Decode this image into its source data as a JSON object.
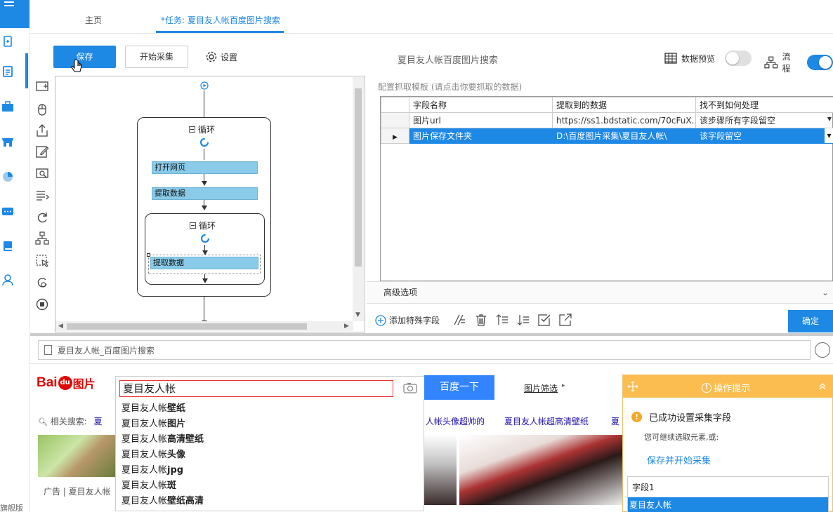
{
  "tabs": {
    "home": "主页",
    "task": "*任务: 夏目友人帐百度图片搜索"
  },
  "toolbar": {
    "save": "保存",
    "start": "开始采集",
    "settings": "设置",
    "task_title": "夏目友人帐百度图片搜索",
    "preview": "数据预览",
    "preview_on": false,
    "flow": "流程",
    "flow_on": true
  },
  "sidebar": {
    "edition": "旗舰版"
  },
  "workflow": {
    "outer_loop": "循环",
    "steps": [
      "打开网页",
      "提取数据"
    ],
    "inner_loop": "循环",
    "inner_step": "提取数据"
  },
  "extract": {
    "panel_title": "配置抓取模板 (请点击你要抓取的数据)",
    "columns": [
      "字段名称",
      "提取到的数据",
      "找不到如何处理"
    ],
    "rows": [
      {
        "name": "图片url",
        "value": "https://ss1.bdstatic.com/70cFuX...",
        "fallback": "该步骤所有字段留空"
      },
      {
        "name": "图片保存文件夹",
        "value": "D:\\百度图片采集\\夏目友人帐\\",
        "fallback": "该字段留空"
      }
    ],
    "selected_row": 1,
    "advanced": "高级选项",
    "add_field": "添加特殊字段",
    "ok": "确定"
  },
  "browser": {
    "address": "夏目友人帐_百度图片搜索",
    "logo_text": "Bai",
    "logo_du": "du",
    "logo_suffix": "图片",
    "query": "夏目友人帐",
    "search_btn": "百度一下",
    "filter": "图片筛选",
    "filter_arrow": "▸",
    "suggestions": [
      {
        "base": "夏目友人帐",
        "bold": "壁纸"
      },
      {
        "base": "夏目友人帐",
        "bold": "图片"
      },
      {
        "base": "夏目友人帐",
        "bold": "高清壁纸"
      },
      {
        "base": "夏目友人帐",
        "bold": "头像"
      },
      {
        "base": "夏目友人帐",
        "bold": "jpg"
      },
      {
        "base": "夏目友人帐",
        "bold": "斑"
      },
      {
        "base": "夏目友人帐",
        "bold": "壁纸高清"
      }
    ],
    "related_label": "相关搜索:",
    "related_first": "夏",
    "related": [
      "人帐头像超帅的",
      "夏目友人帐超高清壁纸",
      "夏"
    ],
    "ad": "广告 | 夏目友人帐"
  },
  "tips": {
    "title": "操作提示",
    "message": "已成功设置采集字段",
    "sub": "您可继续选取元素,或:",
    "link": "保存并开始采集",
    "field_label": "字段1",
    "field_value": "夏目友人帐"
  }
}
